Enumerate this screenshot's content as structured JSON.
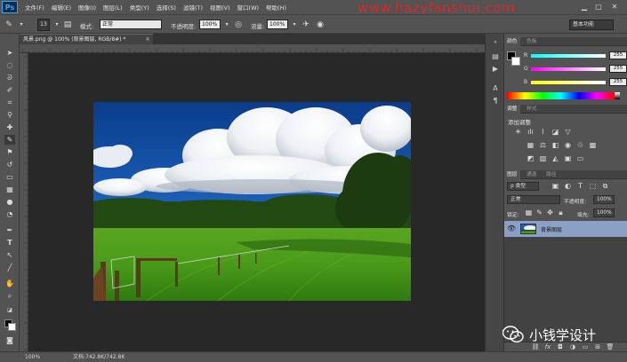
{
  "menubar": {
    "app_icon": "Ps",
    "items": [
      "文件(F)",
      "编辑(E)",
      "图像(I)",
      "图层(L)",
      "类型(Y)",
      "选择(S)",
      "滤镜(T)",
      "视图(V)",
      "窗口(W)",
      "帮助(H)"
    ],
    "watermark_url": "www.hazyfanshui.com",
    "window_controls": [
      "minimize-icon",
      "maximize-icon",
      "close-icon"
    ]
  },
  "options": {
    "brush_size": "13",
    "mode_label": "模式:",
    "mode_value": "正常",
    "opacity_label": "不透明度:",
    "opacity_value": "100%",
    "flow_label": "流量:",
    "flow_value": "100%",
    "workspace": "基本功能"
  },
  "document": {
    "tab_title": "风景.png @ 100% (背景图层, RGB/8#) *",
    "tab_close": "×"
  },
  "status": {
    "zoom": "100%",
    "doc_info": "文档:742.8K/742.8K"
  },
  "color_panel": {
    "tabs": [
      "颜色",
      "色板"
    ],
    "sliders": [
      {
        "label": "R",
        "value": "255"
      },
      {
        "label": "G",
        "value": "255"
      },
      {
        "label": "B",
        "value": "255"
      }
    ],
    "foreground": "#000000",
    "background": "#ffffff"
  },
  "adjustments_panel": {
    "tabs": [
      "调整",
      "样式"
    ],
    "heading": "添加调整"
  },
  "layers_panel": {
    "tabs": [
      "图层",
      "通道",
      "路径"
    ],
    "filter_label": "ρ 类型",
    "blend_mode": "正常",
    "opacity_label": "不透明度:",
    "opacity_value": "100%",
    "lock_label": "锁定:",
    "fill_label": "填充:",
    "fill_value": "100%",
    "layers": [
      {
        "name": "背景图层",
        "visible": true
      }
    ]
  },
  "overlay": {
    "wechat_text": "小钱学设计"
  }
}
